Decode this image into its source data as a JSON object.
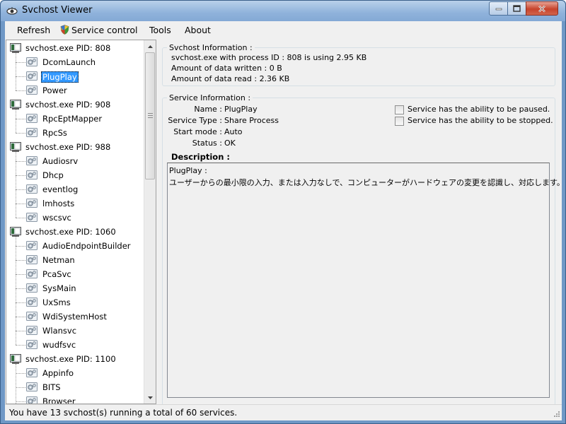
{
  "window": {
    "title": "Svchost Viewer"
  },
  "menu": [
    "Refresh",
    "Service control",
    "Tools",
    "About"
  ],
  "tree": [
    {
      "kind": "host",
      "label": "svchost.exe PID: 808"
    },
    {
      "kind": "service",
      "label": "DcomLaunch"
    },
    {
      "kind": "service",
      "label": "PlugPlay",
      "selected": true
    },
    {
      "kind": "service",
      "label": "Power"
    },
    {
      "kind": "host",
      "label": "svchost.exe PID: 908"
    },
    {
      "kind": "service",
      "label": "RpcEptMapper"
    },
    {
      "kind": "service",
      "label": "RpcSs"
    },
    {
      "kind": "host",
      "label": "svchost.exe PID: 988"
    },
    {
      "kind": "service",
      "label": "Audiosrv"
    },
    {
      "kind": "service",
      "label": "Dhcp"
    },
    {
      "kind": "service",
      "label": "eventlog"
    },
    {
      "kind": "service",
      "label": "lmhosts"
    },
    {
      "kind": "service",
      "label": "wscsvc"
    },
    {
      "kind": "host",
      "label": "svchost.exe PID: 1060"
    },
    {
      "kind": "service",
      "label": "AudioEndpointBuilder"
    },
    {
      "kind": "service",
      "label": "Netman"
    },
    {
      "kind": "service",
      "label": "PcaSvc"
    },
    {
      "kind": "service",
      "label": "SysMain"
    },
    {
      "kind": "service",
      "label": "UxSms"
    },
    {
      "kind": "service",
      "label": "WdiSystemHost"
    },
    {
      "kind": "service",
      "label": "Wlansvc"
    },
    {
      "kind": "service",
      "label": "wudfsvc"
    },
    {
      "kind": "host",
      "label": "svchost.exe PID: 1100"
    },
    {
      "kind": "service",
      "label": "Appinfo"
    },
    {
      "kind": "service",
      "label": "BITS"
    },
    {
      "kind": "service",
      "label": "Browser"
    }
  ],
  "svchost_info": {
    "title": "Svchost Information :",
    "line1": "svchost.exe with process ID : 808 is using 2.95 KB",
    "line2": "Amount of data written : 0 B",
    "line3": "Amount of data read : 2.36 KB"
  },
  "service_info": {
    "title": "Service Information :",
    "name_label": "Name :",
    "name_value": "PlugPlay",
    "type_label": "Service Type :",
    "type_value": "Share Process",
    "start_label": "Start mode :",
    "start_value": "Auto",
    "status_label": "Status :",
    "status_value": "OK",
    "can_pause": "Service has the ability to be paused.",
    "can_stop": "Service has the ability to be stopped."
  },
  "description": {
    "title": "Description :",
    "line1": "PlugPlay :",
    "line2": "ユーザーからの最小限の入力、または入力なしで、コンピューターがハードウェアの変更を認識し、対応します。"
  },
  "status_bar": "You have 13 svchost(s) running a total of 60 services."
}
